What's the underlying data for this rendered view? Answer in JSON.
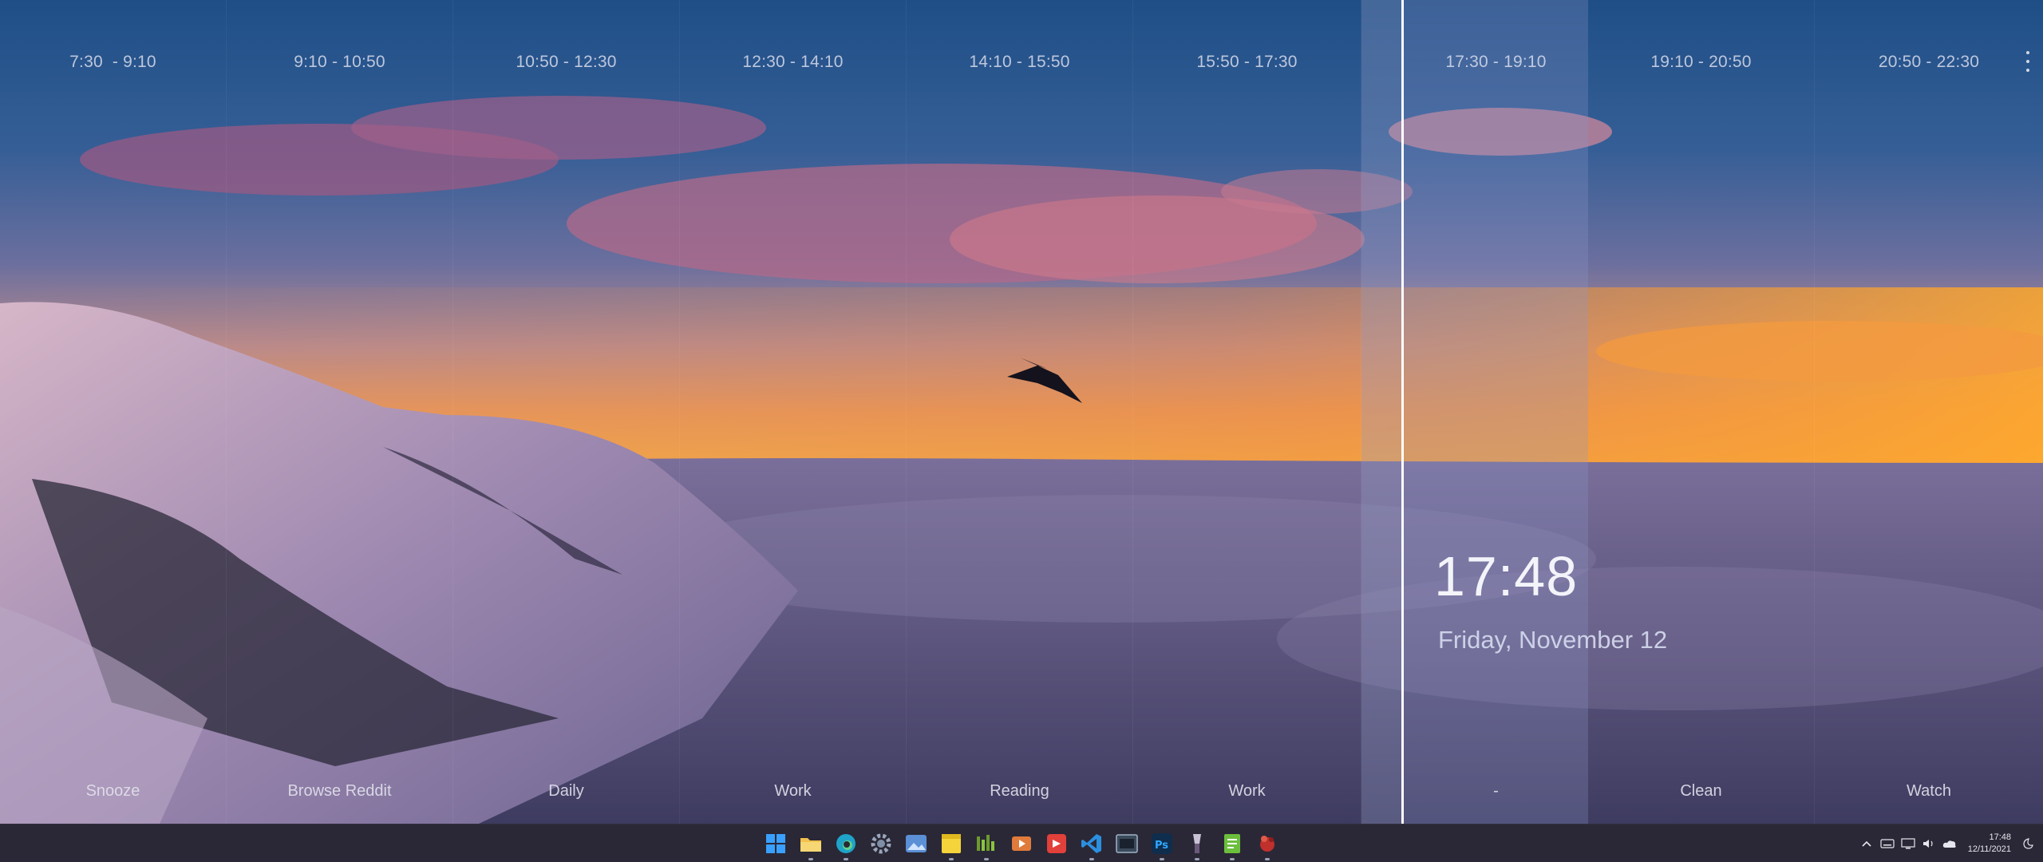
{
  "slots": [
    {
      "time": "7:30  - 9:10",
      "task": "Snooze"
    },
    {
      "time": "9:10 - 10:50",
      "task": "Browse Reddit"
    },
    {
      "time": "10:50 - 12:30",
      "task": "Daily"
    },
    {
      "time": "12:30 - 14:10",
      "task": "Work"
    },
    {
      "time": "14:10 - 15:50",
      "task": "Reading"
    },
    {
      "time": "15:50 - 17:30",
      "task": "Work"
    },
    {
      "time": "17:30 - 19:10",
      "task": "-"
    },
    {
      "time": "19:10 - 20:50",
      "task": "Clean"
    },
    {
      "time": "20:50 - 22:30",
      "task": "Watch"
    }
  ],
  "clock": {
    "time": "17:48",
    "date": "Friday, November 12"
  },
  "taskbar": {
    "apps": [
      {
        "name": "start",
        "icon": "windows-logo-icon",
        "color": "#3aa0ff"
      },
      {
        "name": "file-explorer",
        "icon": "folder-icon",
        "color": "#f2c14e"
      },
      {
        "name": "edge",
        "icon": "edge-browser-icon",
        "color": "#1fa3c9"
      },
      {
        "name": "settings",
        "icon": "gear-icon",
        "color": "#7f8fa6"
      },
      {
        "name": "photos",
        "icon": "photos-icon",
        "color": "#5b8fd6"
      },
      {
        "name": "sticky-notes",
        "icon": "sticky-notes-icon",
        "color": "#f5d33b"
      },
      {
        "name": "nvidia",
        "icon": "nvidia-icon",
        "color": "#6d9b2d"
      },
      {
        "name": "media-player",
        "icon": "media-player-icon",
        "color": "#e07b3b"
      },
      {
        "name": "recorder",
        "icon": "recorder-icon",
        "color": "#e2403a"
      },
      {
        "name": "vscode",
        "icon": "vscode-icon",
        "color": "#2b8fe0"
      },
      {
        "name": "terminal",
        "icon": "terminal-icon",
        "color": "#3b4a5a"
      },
      {
        "name": "photoshop",
        "icon": "photoshop-icon",
        "color": "#0f2d4d"
      },
      {
        "name": "paint-tool",
        "icon": "paint-tool-icon",
        "color": "#6a5a7a"
      },
      {
        "name": "notepad",
        "icon": "notepad-icon",
        "color": "#6cbf3c"
      },
      {
        "name": "game",
        "icon": "game-icon",
        "color": "#c0302c"
      }
    ],
    "tray": {
      "icons": [
        "chevron-up-icon",
        "keyboard-icon",
        "display-icon",
        "volume-icon",
        "cloud-icon"
      ],
      "time": "17:48",
      "date": "12/11/2021"
    }
  }
}
